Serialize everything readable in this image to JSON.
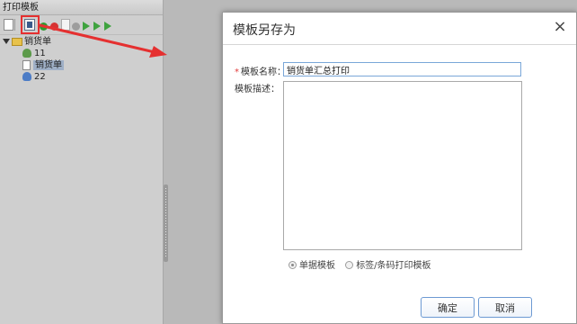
{
  "left_panel": {
    "title": "打印模板",
    "tree": {
      "root_label": "销货单",
      "items": [
        {
          "label": "11",
          "icon": "user-group-icon"
        },
        {
          "label": "销货单",
          "icon": "document-icon",
          "selected": true
        },
        {
          "label": "22",
          "icon": "user-icon"
        }
      ]
    }
  },
  "dialog": {
    "title": "模板另存为",
    "close_icon": "×",
    "name_label": "模板名称：",
    "required_mark": "*",
    "name_value": "销货单汇总打印",
    "desc_label": "模板描述：",
    "desc_value": "",
    "radio_options": [
      {
        "label": "单据模板",
        "checked": true
      },
      {
        "label": "标签/条码打印模板",
        "checked": false
      }
    ],
    "ok_label": "确定",
    "cancel_label": "取消"
  },
  "colors": {
    "highlight": "#e53030",
    "button_border": "#6d9ad3"
  }
}
